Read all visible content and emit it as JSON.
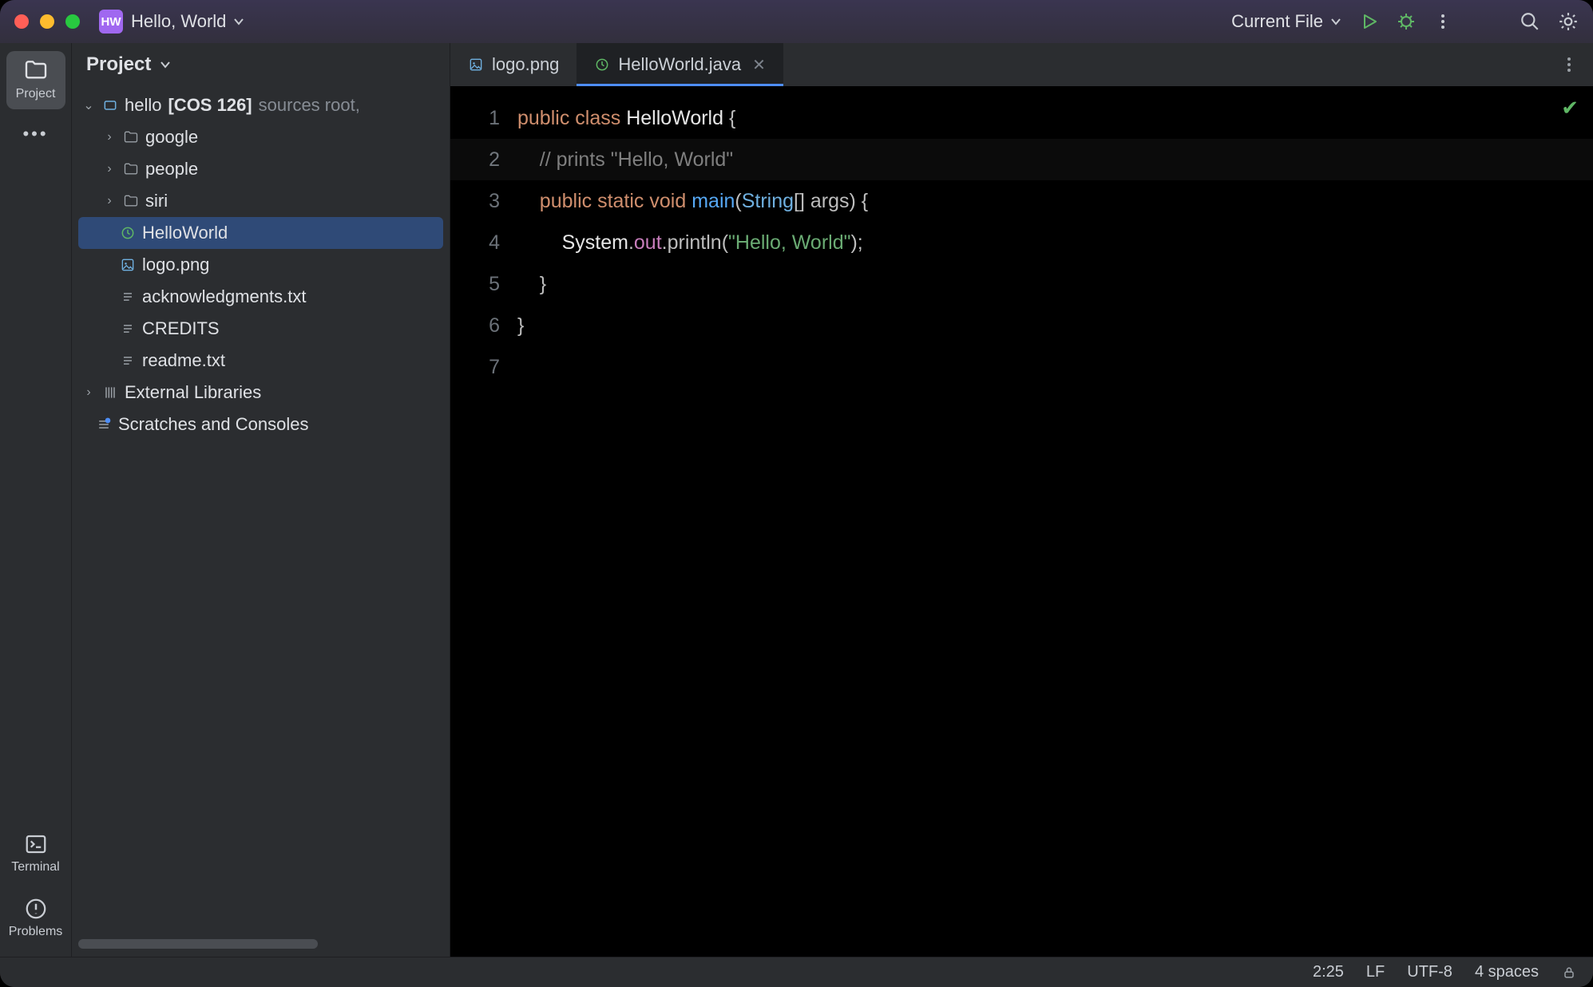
{
  "titlebar": {
    "app_badge": "HW",
    "app_name": "Hello, World",
    "run_config": "Current File"
  },
  "toolstrip": {
    "project": "Project",
    "terminal": "Terminal",
    "problems": "Problems"
  },
  "project": {
    "header": "Project",
    "root": {
      "name": "hello",
      "tag": "[COS 126]",
      "hint": "sources root,"
    },
    "folders": [
      "google",
      "people",
      "siri"
    ],
    "files": {
      "java": "HelloWorld",
      "img": "logo.png",
      "ack": "acknowledgments.txt",
      "credits": "CREDITS",
      "readme": "readme.txt"
    },
    "external": "External Libraries",
    "scratches": "Scratches and Consoles"
  },
  "tabs": [
    {
      "label": "logo.png"
    },
    {
      "label": "HelloWorld.java"
    }
  ],
  "code": {
    "line_numbers": [
      "1",
      "2",
      "3",
      "4",
      "5",
      "6",
      "7"
    ],
    "l1a": "public",
    "l1b": "class",
    "l1c": "HelloWorld",
    "l1d": " {",
    "l2": "// prints \"Hello, World\"",
    "l3a": "public",
    "l3b": "static",
    "l3c": "void",
    "l3d": "main",
    "l3e": "(",
    "l3f": "String",
    "l3g": "[] args) {",
    "l4a": "System",
    "l4b": ".",
    "l4c": "out",
    "l4d": ".println(",
    "l4e": "\"Hello, World\"",
    "l4f": ");",
    "l5": "    }",
    "l6": "}"
  },
  "status": {
    "lncol": "2:25",
    "eol": "LF",
    "enc": "UTF-8",
    "indent": "4 spaces"
  }
}
